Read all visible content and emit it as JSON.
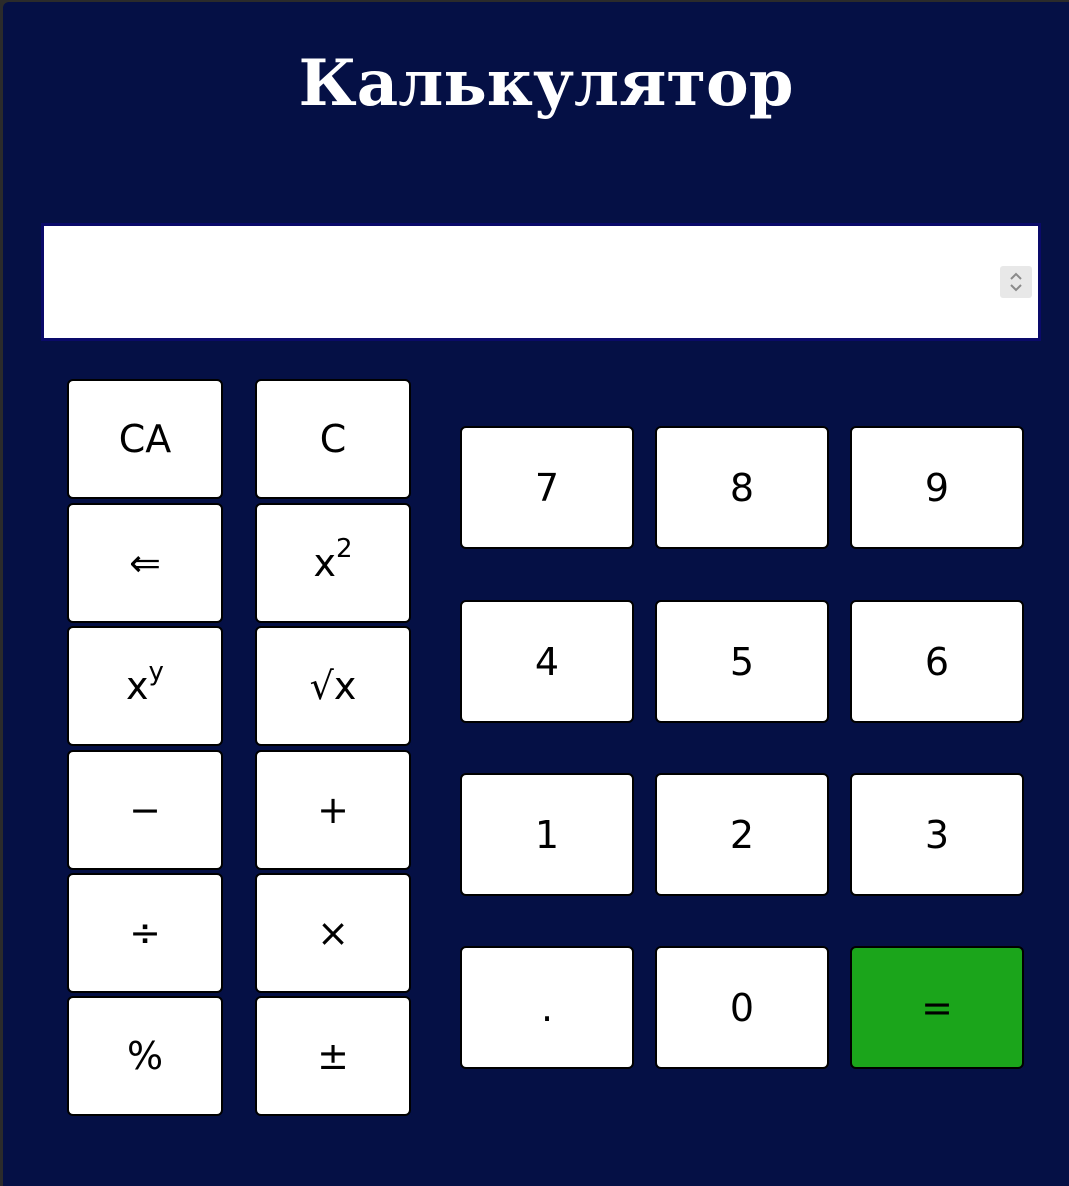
{
  "title": "Калькулятор",
  "display": {
    "value": ""
  },
  "buttons": {
    "clear_all": "CA",
    "clear": "C",
    "backspace": "⇐",
    "square_base": "x",
    "square_exp": "2",
    "power_base": "x",
    "power_exp": "y",
    "sqrt": "√x",
    "minus": "−",
    "plus": "+",
    "divide": "÷",
    "multiply": "×",
    "percent": "%",
    "plus_minus": "±",
    "d7": "7",
    "d8": "8",
    "d9": "9",
    "d4": "4",
    "d5": "5",
    "d6": "6",
    "d1": "1",
    "d2": "2",
    "d3": "3",
    "dot": ".",
    "d0": "0",
    "equals": "="
  },
  "colors": {
    "background": "#051045",
    "equals_button": "#1ba51b",
    "display_border": "#0a0a6a"
  },
  "icons": {
    "spinner": "up-down-spinner-icon"
  }
}
